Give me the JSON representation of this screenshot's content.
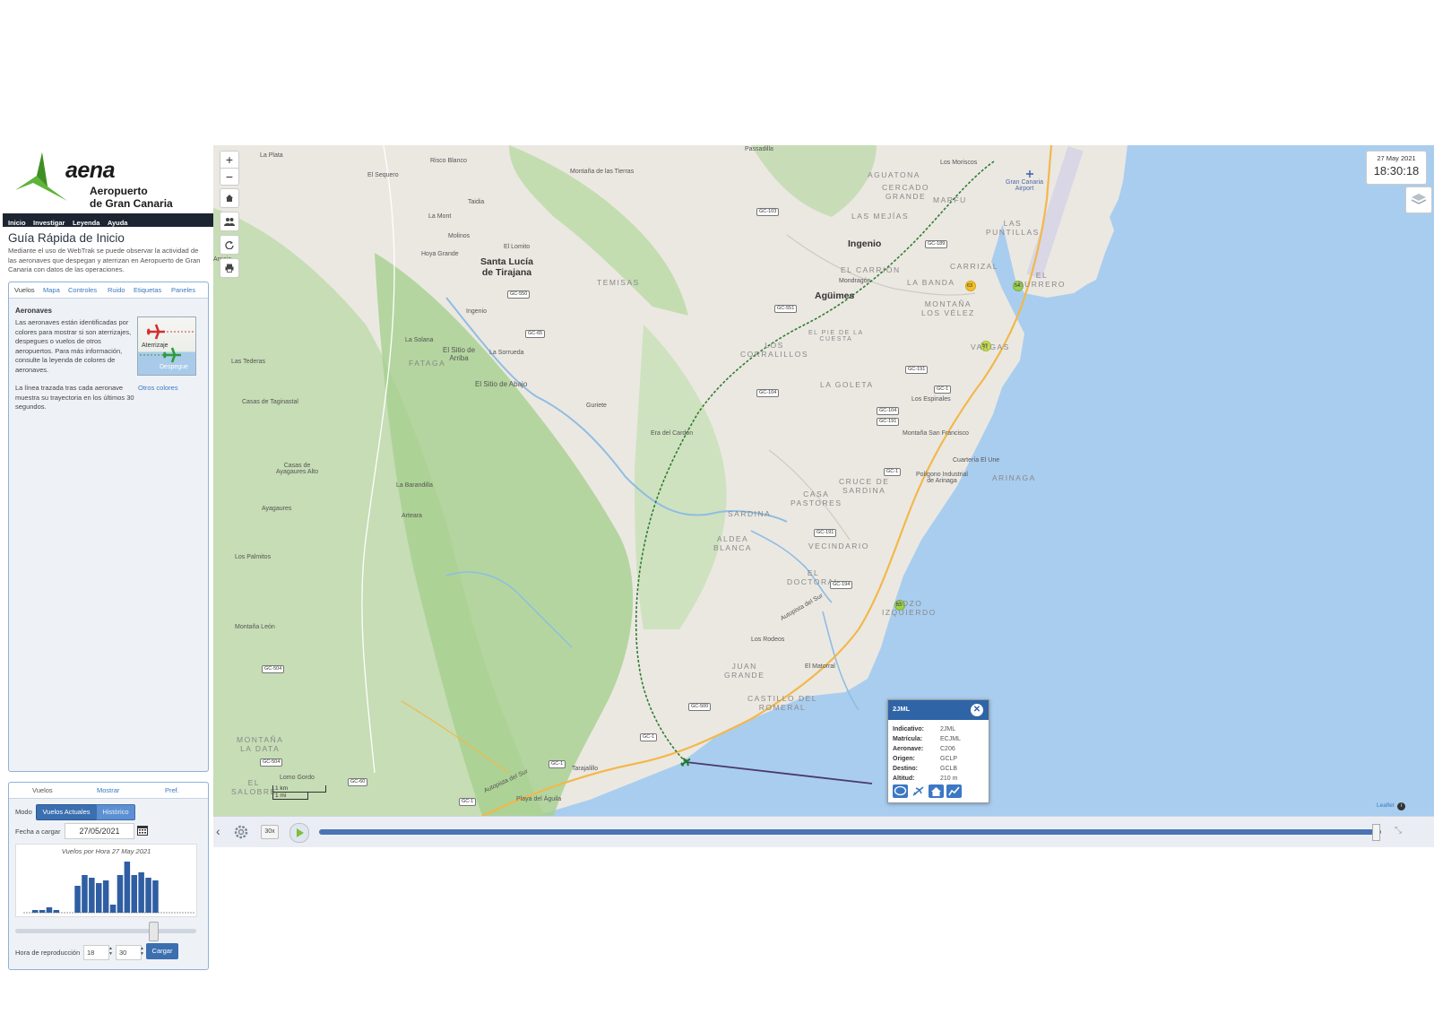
{
  "brand": {
    "name": "aena",
    "subtitle_line1": "Aeropuerto",
    "subtitle_line2": "de Gran Canaria",
    "color": "#5fb33a"
  },
  "topnav": [
    "Inicio",
    "Investigar",
    "Leyenda",
    "Ayuda"
  ],
  "guide": {
    "title": "Guía Rápida de Inicio",
    "text": "Mediante el uso de WebTrak se puede observar la actividad de las aeronaves que despegan y aterrizan en Aeropuerto de Gran Canaria con datos de las operaciones."
  },
  "info_panel": {
    "tabs": [
      "Vuelos",
      "Mapa",
      "Controles",
      "Ruido",
      "Etiquetas",
      "Paneles"
    ],
    "heading": "Aeronaves",
    "text": "Las aeronaves están identificadas por colores para mostrar si son aterrizajes, despegues o vuelos de otros aeropuertos. Para más información, consulte la leyenda de colores de aeronaves.",
    "image_labels": {
      "landing": "Aterrizaje",
      "takeoff": "Despegue"
    },
    "text2": "La línea trazada tras cada aeronave muestra su trayectoria en los últimos 30 segundos.",
    "link": "Otros colores"
  },
  "control_panel": {
    "tabs": [
      "Vuelos",
      "Mostrar",
      "Pref."
    ],
    "modo_label": "Modo",
    "mode_current": "Vuelos Actuales",
    "mode_history": "Histórico",
    "fecha_label": "Fecha a cargar",
    "fecha_value": "27/05/2021",
    "histogram_title": "Vuelos por Hora 27 May 2021",
    "histogram_values": [
      0,
      1,
      1,
      2,
      1,
      0,
      0,
      10,
      14,
      13,
      11,
      12,
      3,
      14,
      19,
      14,
      15,
      13,
      12,
      0,
      0,
      0,
      0,
      0
    ],
    "hora_label": "Hora de reproducción",
    "hour": "18",
    "minute": "30",
    "load_button": "Cargar"
  },
  "clock": {
    "date": "27 May 2021",
    "time": "18:30:18"
  },
  "map": {
    "zoom_in": "+",
    "zoom_out": "−",
    "places": [
      {
        "id": "plata",
        "text": "La Plata"
      },
      {
        "id": "risco",
        "text": "Risco Blanco"
      },
      {
        "id": "sequero",
        "text": "El Sequero"
      },
      {
        "id": "montana-tierras",
        "text": "Montaña de las Tierras"
      },
      {
        "id": "passadilla",
        "text": "Passadilla"
      },
      {
        "id": "tasarte",
        "text": "Taidia"
      },
      {
        "id": "lamont",
        "text": "La Mont"
      },
      {
        "id": "molinos",
        "text": "Molinos"
      },
      {
        "id": "hoya",
        "text": "Hoya Grande"
      },
      {
        "id": "lomito",
        "text": "El Lomito"
      },
      {
        "id": "santa-lucia",
        "text": "Santa Lucía\nde Tirajana"
      },
      {
        "id": "temisas",
        "text": "TEMISAS"
      },
      {
        "id": "ingenio-small",
        "text": "Ingenio"
      },
      {
        "id": "solana",
        "text": "La Solana"
      },
      {
        "id": "fataga",
        "text": "FATAGA"
      },
      {
        "id": "sitio-arriba",
        "text": "El Sitio de\nArriba"
      },
      {
        "id": "sorrueda",
        "text": "La Sorrueda"
      },
      {
        "id": "sitio-abajo",
        "text": "El Sitio de Abajo"
      },
      {
        "id": "tederas",
        "text": "Las Tederas"
      },
      {
        "id": "taginastal",
        "text": "Casas de Taginastal"
      },
      {
        "id": "guriete",
        "text": "Guriete"
      },
      {
        "id": "era-cardon",
        "text": "Era del Cardón"
      },
      {
        "id": "casas-ayaguares",
        "text": "Casas de\nAyagaures Alto"
      },
      {
        "id": "barandilla",
        "text": "La Barandilla"
      },
      {
        "id": "arteara",
        "text": "Arteara"
      },
      {
        "id": "ayagaures",
        "text": "Ayagaures"
      },
      {
        "id": "palmitos",
        "text": "Los Palmitos"
      },
      {
        "id": "montana-leon",
        "text": "Montaña León"
      },
      {
        "id": "montana-data",
        "text": "MONTAÑA\nLA DATA"
      },
      {
        "id": "salobre",
        "text": "EL\nSALOBRE"
      },
      {
        "id": "lomo-gordo",
        "text": "Lomo Gordo"
      },
      {
        "id": "tarajalillo",
        "text": "Tarajalillo"
      },
      {
        "id": "playa-aguila",
        "text": "Playa del Águila"
      },
      {
        "id": "juan-grande",
        "text": "JUAN\nGRANDE"
      },
      {
        "id": "castillo",
        "text": "CASTILLO DEL\nROMERAL"
      },
      {
        "id": "matorral",
        "text": "El Matorral"
      },
      {
        "id": "rodeos",
        "text": "Los Rodeos"
      },
      {
        "id": "sardina",
        "text": "SARDINA"
      },
      {
        "id": "aldea-blanca",
        "text": "ALDEA\nBLANCA"
      },
      {
        "id": "vecindario",
        "text": "VECINDARIO"
      },
      {
        "id": "doctoral",
        "text": "EL\nDOCTORAL"
      },
      {
        "id": "pozo",
        "text": "POZO\nIZQUIERDO"
      },
      {
        "id": "casa-pastores",
        "text": "CASA\nPASTORES"
      },
      {
        "id": "cruce-sardina",
        "text": "CRUCE DE\nSARDINA"
      },
      {
        "id": "arinaga",
        "text": "ARINAGA"
      },
      {
        "id": "poligono",
        "text": "Polígono Industrial\nde Arinaga"
      },
      {
        "id": "cuarteria",
        "text": "Cuartería El Une"
      },
      {
        "id": "montana-sf",
        "text": "Montaña San Francisco"
      },
      {
        "id": "espinales",
        "text": "Los Espinales"
      },
      {
        "id": "goleta",
        "text": "LA GOLETA"
      },
      {
        "id": "pie-cuesta",
        "text": "EL PIE DE LA\nCUESTA"
      },
      {
        "id": "corralillos",
        "text": "LOS\nCORRALILLOS"
      },
      {
        "id": "aguimes",
        "text": "Agüimes"
      },
      {
        "id": "mondragon",
        "text": "Mondragón"
      },
      {
        "id": "carrion",
        "text": "EL CARRIÓN"
      },
      {
        "id": "ingenio",
        "text": "Ingenio"
      },
      {
        "id": "mejias",
        "text": "LAS MEJÍAS"
      },
      {
        "id": "aguatona",
        "text": "AGUATONA"
      },
      {
        "id": "cercado",
        "text": "CERCADO\nGRANDE"
      },
      {
        "id": "marfu",
        "text": "MARFU"
      },
      {
        "id": "moriscos",
        "text": "Los Moriscos"
      },
      {
        "id": "airport",
        "text": "Gran Canaria\nAirport"
      },
      {
        "id": "puntillas",
        "text": "LAS\nPUNTILLAS"
      },
      {
        "id": "carrizal",
        "text": "CARRIZAL"
      },
      {
        "id": "banda",
        "text": "LA BANDA"
      },
      {
        "id": "montana-velez",
        "text": "MONTAÑA\nLOS VÉLEZ"
      },
      {
        "id": "burrero",
        "text": "EL\nBURRERO"
      },
      {
        "id": "vargas",
        "text": "VARGAS"
      },
      {
        "id": "autopista-sur",
        "text": "Autopista del Sur"
      },
      {
        "id": "autopista-sur2",
        "text": "Autopista del Sur"
      },
      {
        "id": "arnejo",
        "text": "Arnejo"
      }
    ],
    "road_labels": [
      "GC-103",
      "GC-189",
      "GC-550",
      "GC-65",
      "GC-551",
      "GC-104",
      "GC-191",
      "GC-1",
      "GC-104",
      "GC-191",
      "GC-1",
      "GC-191",
      "GC-194",
      "GC-500",
      "GC-1",
      "GC-1",
      "GC-504",
      "GC-504",
      "GC-60",
      "GC-1"
    ],
    "noise_monitors": [
      "63",
      "54",
      "57",
      "53"
    ],
    "scale_km": "1 km",
    "scale_mi": "1 mi",
    "attribution": "Leaflet"
  },
  "flight_popup": {
    "title": "2JML",
    "rows": [
      {
        "k": "Indicativo:",
        "v": "2JML"
      },
      {
        "k": "Matrícula:",
        "v": "ECJML"
      },
      {
        "k": "Aeronave:",
        "v": "C206"
      },
      {
        "k": "Origen:",
        "v": "GCLP"
      },
      {
        "k": "Destino:",
        "v": "GCLB"
      },
      {
        "k": "Altitud:",
        "v": "210 m"
      }
    ]
  },
  "playback": {
    "speed": "30x",
    "progress": 0.995
  },
  "colors": {
    "nav_dark": "#1d2532",
    "accent_blue": "#3b6fb0",
    "track_green": "#2e7d32",
    "sea": "#a9cdef",
    "land": "#ebe8e2",
    "relief": "#b9d9a5"
  }
}
